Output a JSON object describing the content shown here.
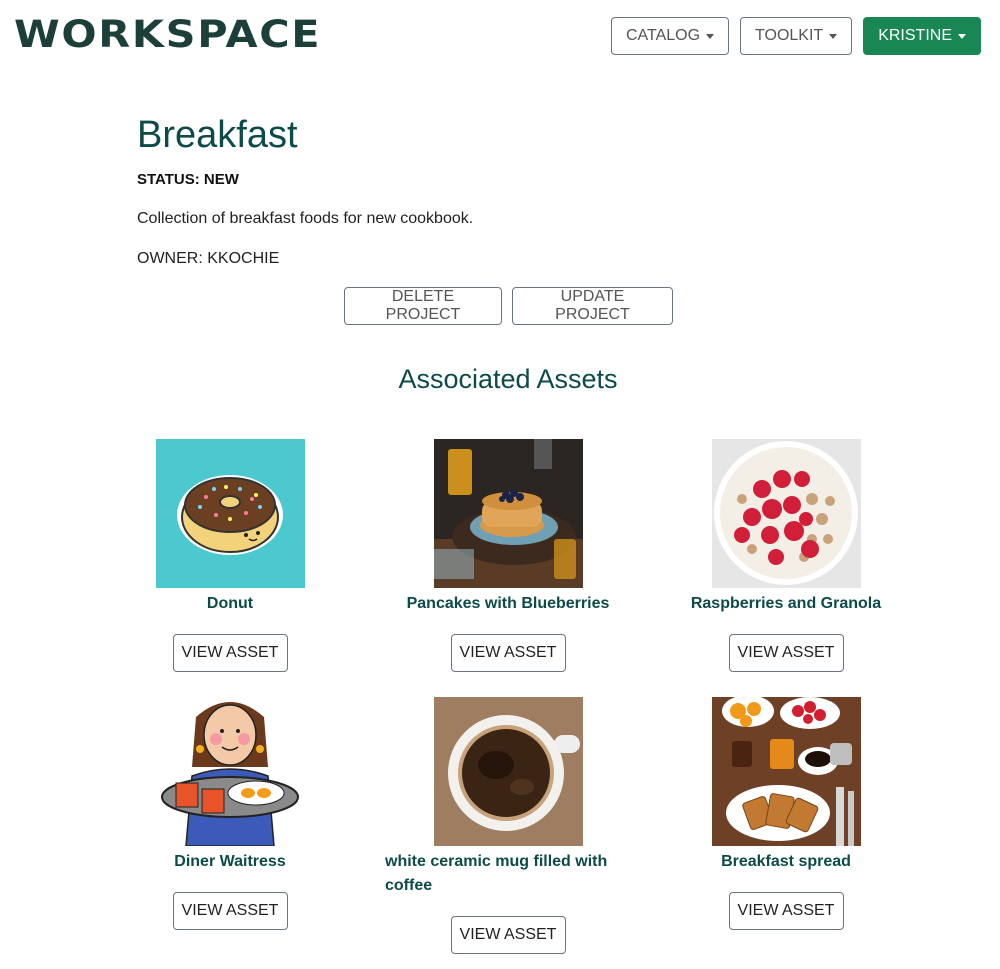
{
  "header": {
    "logo": "WORKSPACE",
    "nav": {
      "catalog": "CATALOG",
      "toolkit": "TOOLKIT",
      "user": "KRISTINE"
    }
  },
  "project": {
    "title": "Breakfast",
    "status": "STATUS: NEW",
    "description": "Collection of breakfast foods for new cookbook.",
    "owner": "OWNER: KKOCHIE",
    "delete_label": "DELETE PROJECT",
    "update_label": "UPDATE PROJECT"
  },
  "assets_section": {
    "title": "Associated Assets",
    "view_label": "VIEW ASSET",
    "items": [
      {
        "name": "Donut",
        "icon": "donut-image"
      },
      {
        "name": "Pancakes with Blueberries",
        "icon": "pancakes-image"
      },
      {
        "name": "Raspberries and Granola",
        "icon": "raspberries-image"
      },
      {
        "name": "Diner Waitress",
        "icon": "waitress-image"
      },
      {
        "name": "white ceramic mug filled with coffee",
        "icon": "coffee-image"
      },
      {
        "name": "Breakfast spread",
        "icon": "breakfast-spread-image"
      }
    ]
  },
  "colors": {
    "brand": "#1d3f3a",
    "accent": "#0d4a4a",
    "user_button": "#198754"
  }
}
